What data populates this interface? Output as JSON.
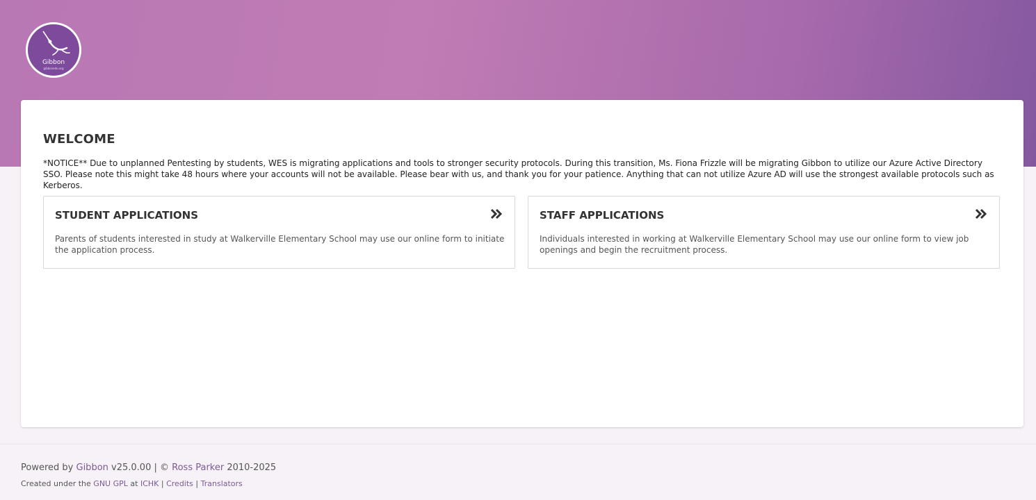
{
  "brand": {
    "logo_text": "Gibbon",
    "logo_subtext": "gibbonedu.org",
    "accent": "#7d4a9c"
  },
  "welcome": {
    "title": "WELCOME",
    "notice": "*NOTICE** Due to unplanned Pentesting by students, WES is migrating applications and tools to stronger security protocols. During this transition, Ms. Fiona Frizzle will be migrating Gibbon to utilize our Azure Active Directory SSO. Please note this might take 48 hours where your accounts will not be available. Please bear with us, and thank you for your patience. Anything that can not utilize Azure AD will use the strongest available protocols such as Kerberos."
  },
  "applications": [
    {
      "title": "STUDENT APPLICATIONS",
      "description": "Parents of students interested in study at Walkerville Elementary School may use our online form to initiate the application process.",
      "icon": "double-chevron-right-icon"
    },
    {
      "title": "STAFF APPLICATIONS",
      "description": "Individuals interested in working at Walkerville Elementary School may use our online form to view job openings and begin the recruitment process.",
      "icon": "double-chevron-right-icon"
    }
  ],
  "footer": {
    "powered_by": "Powered by",
    "gibbon_link": "Gibbon",
    "version": "v25.0.00 | ©",
    "author_link": "Ross Parker",
    "years": "2010-2025",
    "created_under": "Created under the",
    "license_link": "GNU GPL",
    "at": "at",
    "ichk_link": "ICHK",
    "sep1": "|",
    "credits_link": "Credits",
    "sep2": "|",
    "translators_link": "Translators"
  }
}
